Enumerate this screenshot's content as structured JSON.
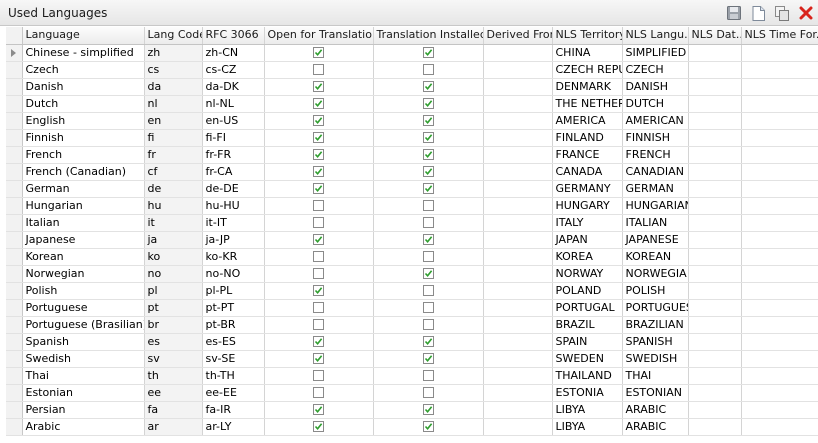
{
  "panel": {
    "title": "Used Languages"
  },
  "toolbar": {
    "save_icon": "save-icon",
    "new_icon": "new-document-icon",
    "copy_icon": "copy-icon",
    "delete_icon": "delete-icon"
  },
  "colors": {
    "check": "#2f9e2f",
    "delete": "#d8241c"
  },
  "columns": [
    "Language",
    "Lang Code",
    "RFC 3066",
    "Open for Translation",
    "Translation Installed",
    "Derived From",
    "NLS Territory",
    "NLS Langu...",
    "NLS Dat...",
    "NLS Time For..."
  ],
  "rows": [
    {
      "language": "Chinese - simplified",
      "code": "zh",
      "rfc": "zh-CN",
      "open": true,
      "installed": true,
      "derived": "",
      "territory": "CHINA",
      "nls_lang": "SIMPLIFIED",
      "current": true
    },
    {
      "language": "Czech",
      "code": "cs",
      "rfc": "cs-CZ",
      "open": false,
      "installed": false,
      "derived": "",
      "territory": "CZECH REPU",
      "nls_lang": "CZECH"
    },
    {
      "language": "Danish",
      "code": "da",
      "rfc": "da-DK",
      "open": true,
      "installed": true,
      "derived": "",
      "territory": "DENMARK",
      "nls_lang": "DANISH"
    },
    {
      "language": "Dutch",
      "code": "nl",
      "rfc": "nl-NL",
      "open": true,
      "installed": true,
      "derived": "",
      "territory": "THE NETHER",
      "nls_lang": "DUTCH"
    },
    {
      "language": "English",
      "code": "en",
      "rfc": "en-US",
      "open": true,
      "installed": true,
      "derived": "",
      "territory": "AMERICA",
      "nls_lang": "AMERICAN"
    },
    {
      "language": "Finnish",
      "code": "fi",
      "rfc": "fi-FI",
      "open": true,
      "installed": true,
      "derived": "",
      "territory": "FINLAND",
      "nls_lang": "FINNISH"
    },
    {
      "language": "French",
      "code": "fr",
      "rfc": "fr-FR",
      "open": true,
      "installed": true,
      "derived": "",
      "territory": "FRANCE",
      "nls_lang": "FRENCH"
    },
    {
      "language": "French (Canadian)",
      "code": "cf",
      "rfc": "fr-CA",
      "open": true,
      "installed": true,
      "derived": "",
      "territory": "CANADA",
      "nls_lang": "CANADIAN F"
    },
    {
      "language": "German",
      "code": "de",
      "rfc": "de-DE",
      "open": true,
      "installed": true,
      "derived": "",
      "territory": "GERMANY",
      "nls_lang": "GERMAN"
    },
    {
      "language": "Hungarian",
      "code": "hu",
      "rfc": "hu-HU",
      "open": false,
      "installed": false,
      "derived": "",
      "territory": "HUNGARY",
      "nls_lang": "HUNGARIAN"
    },
    {
      "language": "Italian",
      "code": "it",
      "rfc": "it-IT",
      "open": false,
      "installed": false,
      "derived": "",
      "territory": "ITALY",
      "nls_lang": "ITALIAN"
    },
    {
      "language": "Japanese",
      "code": "ja",
      "rfc": "ja-JP",
      "open": true,
      "installed": true,
      "derived": "",
      "territory": "JAPAN",
      "nls_lang": "JAPANESE"
    },
    {
      "language": "Korean",
      "code": "ko",
      "rfc": "ko-KR",
      "open": false,
      "installed": false,
      "derived": "",
      "territory": "KOREA",
      "nls_lang": "KOREAN"
    },
    {
      "language": "Norwegian",
      "code": "no",
      "rfc": "no-NO",
      "open": false,
      "installed": true,
      "derived": "",
      "territory": "NORWAY",
      "nls_lang": "NORWEGIA"
    },
    {
      "language": "Polish",
      "code": "pl",
      "rfc": "pl-PL",
      "open": true,
      "installed": false,
      "derived": "",
      "territory": "POLAND",
      "nls_lang": "POLISH"
    },
    {
      "language": "Portuguese",
      "code": "pt",
      "rfc": "pt-PT",
      "open": false,
      "installed": false,
      "derived": "",
      "territory": "PORTUGAL",
      "nls_lang": "PORTUGUES"
    },
    {
      "language": "Portuguese (Brasilian)",
      "code": "br",
      "rfc": "pt-BR",
      "open": false,
      "installed": false,
      "derived": "",
      "territory": "BRAZIL",
      "nls_lang": "BRAZILIAN"
    },
    {
      "language": "Spanish",
      "code": "es",
      "rfc": "es-ES",
      "open": true,
      "installed": true,
      "derived": "",
      "territory": "SPAIN",
      "nls_lang": "SPANISH"
    },
    {
      "language": "Swedish",
      "code": "sv",
      "rfc": "sv-SE",
      "open": true,
      "installed": true,
      "derived": "",
      "territory": "SWEDEN",
      "nls_lang": "SWEDISH"
    },
    {
      "language": "Thai",
      "code": "th",
      "rfc": "th-TH",
      "open": false,
      "installed": false,
      "derived": "",
      "territory": "THAILAND",
      "nls_lang": "THAI"
    },
    {
      "language": "Estonian",
      "code": "ee",
      "rfc": "ee-EE",
      "open": false,
      "installed": false,
      "derived": "",
      "territory": "ESTONIA",
      "nls_lang": "ESTONIAN"
    },
    {
      "language": "Persian",
      "code": "fa",
      "rfc": "fa-IR",
      "open": true,
      "installed": true,
      "derived": "",
      "territory": "LIBYA",
      "nls_lang": "ARABIC"
    },
    {
      "language": "Arabic",
      "code": "ar",
      "rfc": "ar-LY",
      "open": true,
      "installed": true,
      "derived": "",
      "territory": "LIBYA",
      "nls_lang": "ARABIC"
    }
  ]
}
